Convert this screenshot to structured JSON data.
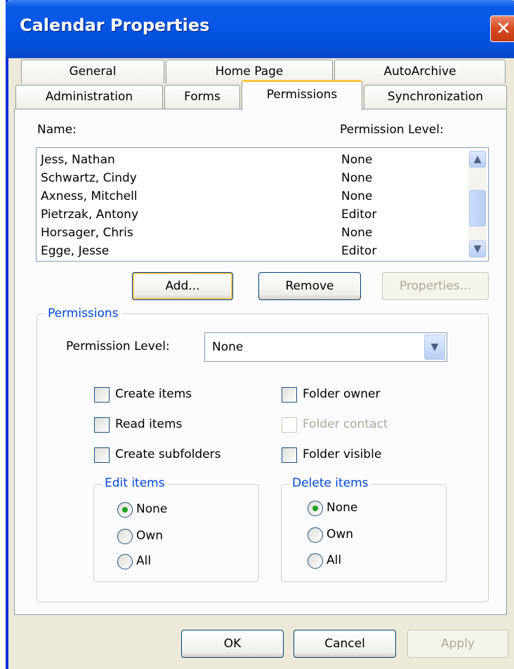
{
  "window": {
    "title": "Calendar Properties",
    "close_glyph": "✕"
  },
  "tabs": {
    "row1": [
      "General",
      "Home Page",
      "AutoArchive"
    ],
    "row2": [
      "Administration",
      "Forms",
      "Permissions",
      "Synchronization"
    ],
    "active": "Permissions"
  },
  "list": {
    "name_header": "Name:",
    "level_header": "Permission Level:",
    "rows": [
      {
        "name": "Jess, Nathan",
        "level": "None"
      },
      {
        "name": "Schwartz, Cindy",
        "level": "None"
      },
      {
        "name": "Axness, Mitchell",
        "level": "None"
      },
      {
        "name": "Pietrzak, Antony",
        "level": "Editor"
      },
      {
        "name": "Horsager, Chris",
        "level": "None"
      },
      {
        "name": "Egge, Jesse",
        "level": "Editor"
      }
    ]
  },
  "buttons": {
    "add": "Add...",
    "remove": "Remove",
    "properties": "Properties...",
    "ok": "OK",
    "cancel": "Cancel",
    "apply": "Apply"
  },
  "permissions": {
    "group_title": "Permissions",
    "level_label": "Permission Level:",
    "level_value": "None",
    "checkboxes": {
      "create_items": "Create items",
      "read_items": "Read items",
      "create_subfolders": "Create subfolders",
      "folder_owner": "Folder owner",
      "folder_contact": "Folder contact",
      "folder_visible": "Folder visible"
    },
    "edit_items": {
      "title": "Edit items",
      "options": [
        "None",
        "Own",
        "All"
      ],
      "selected": "None"
    },
    "delete_items": {
      "title": "Delete items",
      "options": [
        "None",
        "Own",
        "All"
      ],
      "selected": "None"
    }
  },
  "icons": {
    "scroll_up": "chevron-up-icon",
    "scroll_down": "chevron-down-icon",
    "combo": "chevron-down-icon"
  },
  "colors": {
    "titlebar": "#0A5BE8",
    "face": "#ECE9D8",
    "accent_blue": "#0046D5",
    "close_red": "#D8491F",
    "tab_highlight": "#FFC83C"
  }
}
